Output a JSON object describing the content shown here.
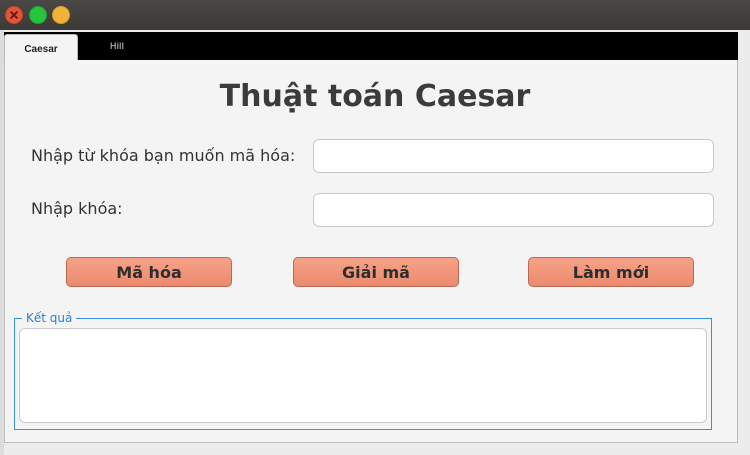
{
  "window": {
    "controls": [
      "close-icon",
      "maximize-icon",
      "minimize-icon"
    ],
    "colors": {
      "close": "#e2553a",
      "maximize": "#27c43f",
      "minimize": "#f1b23b"
    }
  },
  "tabs": [
    {
      "label": "Caesar",
      "active": true
    },
    {
      "label": "Hill",
      "active": false
    }
  ],
  "main": {
    "title": "Thuật toán Caesar",
    "keyword_label": "Nhập từ khóa bạn muốn mã hóa:",
    "keyword_value": "",
    "key_label": "Nhập khóa:",
    "key_value": "",
    "buttons": {
      "encrypt": "Mã hóa",
      "decrypt": "Giải mã",
      "reset": "Làm mới"
    },
    "result": {
      "legend": "Kết quả",
      "value": ""
    }
  },
  "colors": {
    "button_fill": "#f0967a",
    "group_border": "#3b8ee0",
    "tabstrip": "#000000"
  }
}
